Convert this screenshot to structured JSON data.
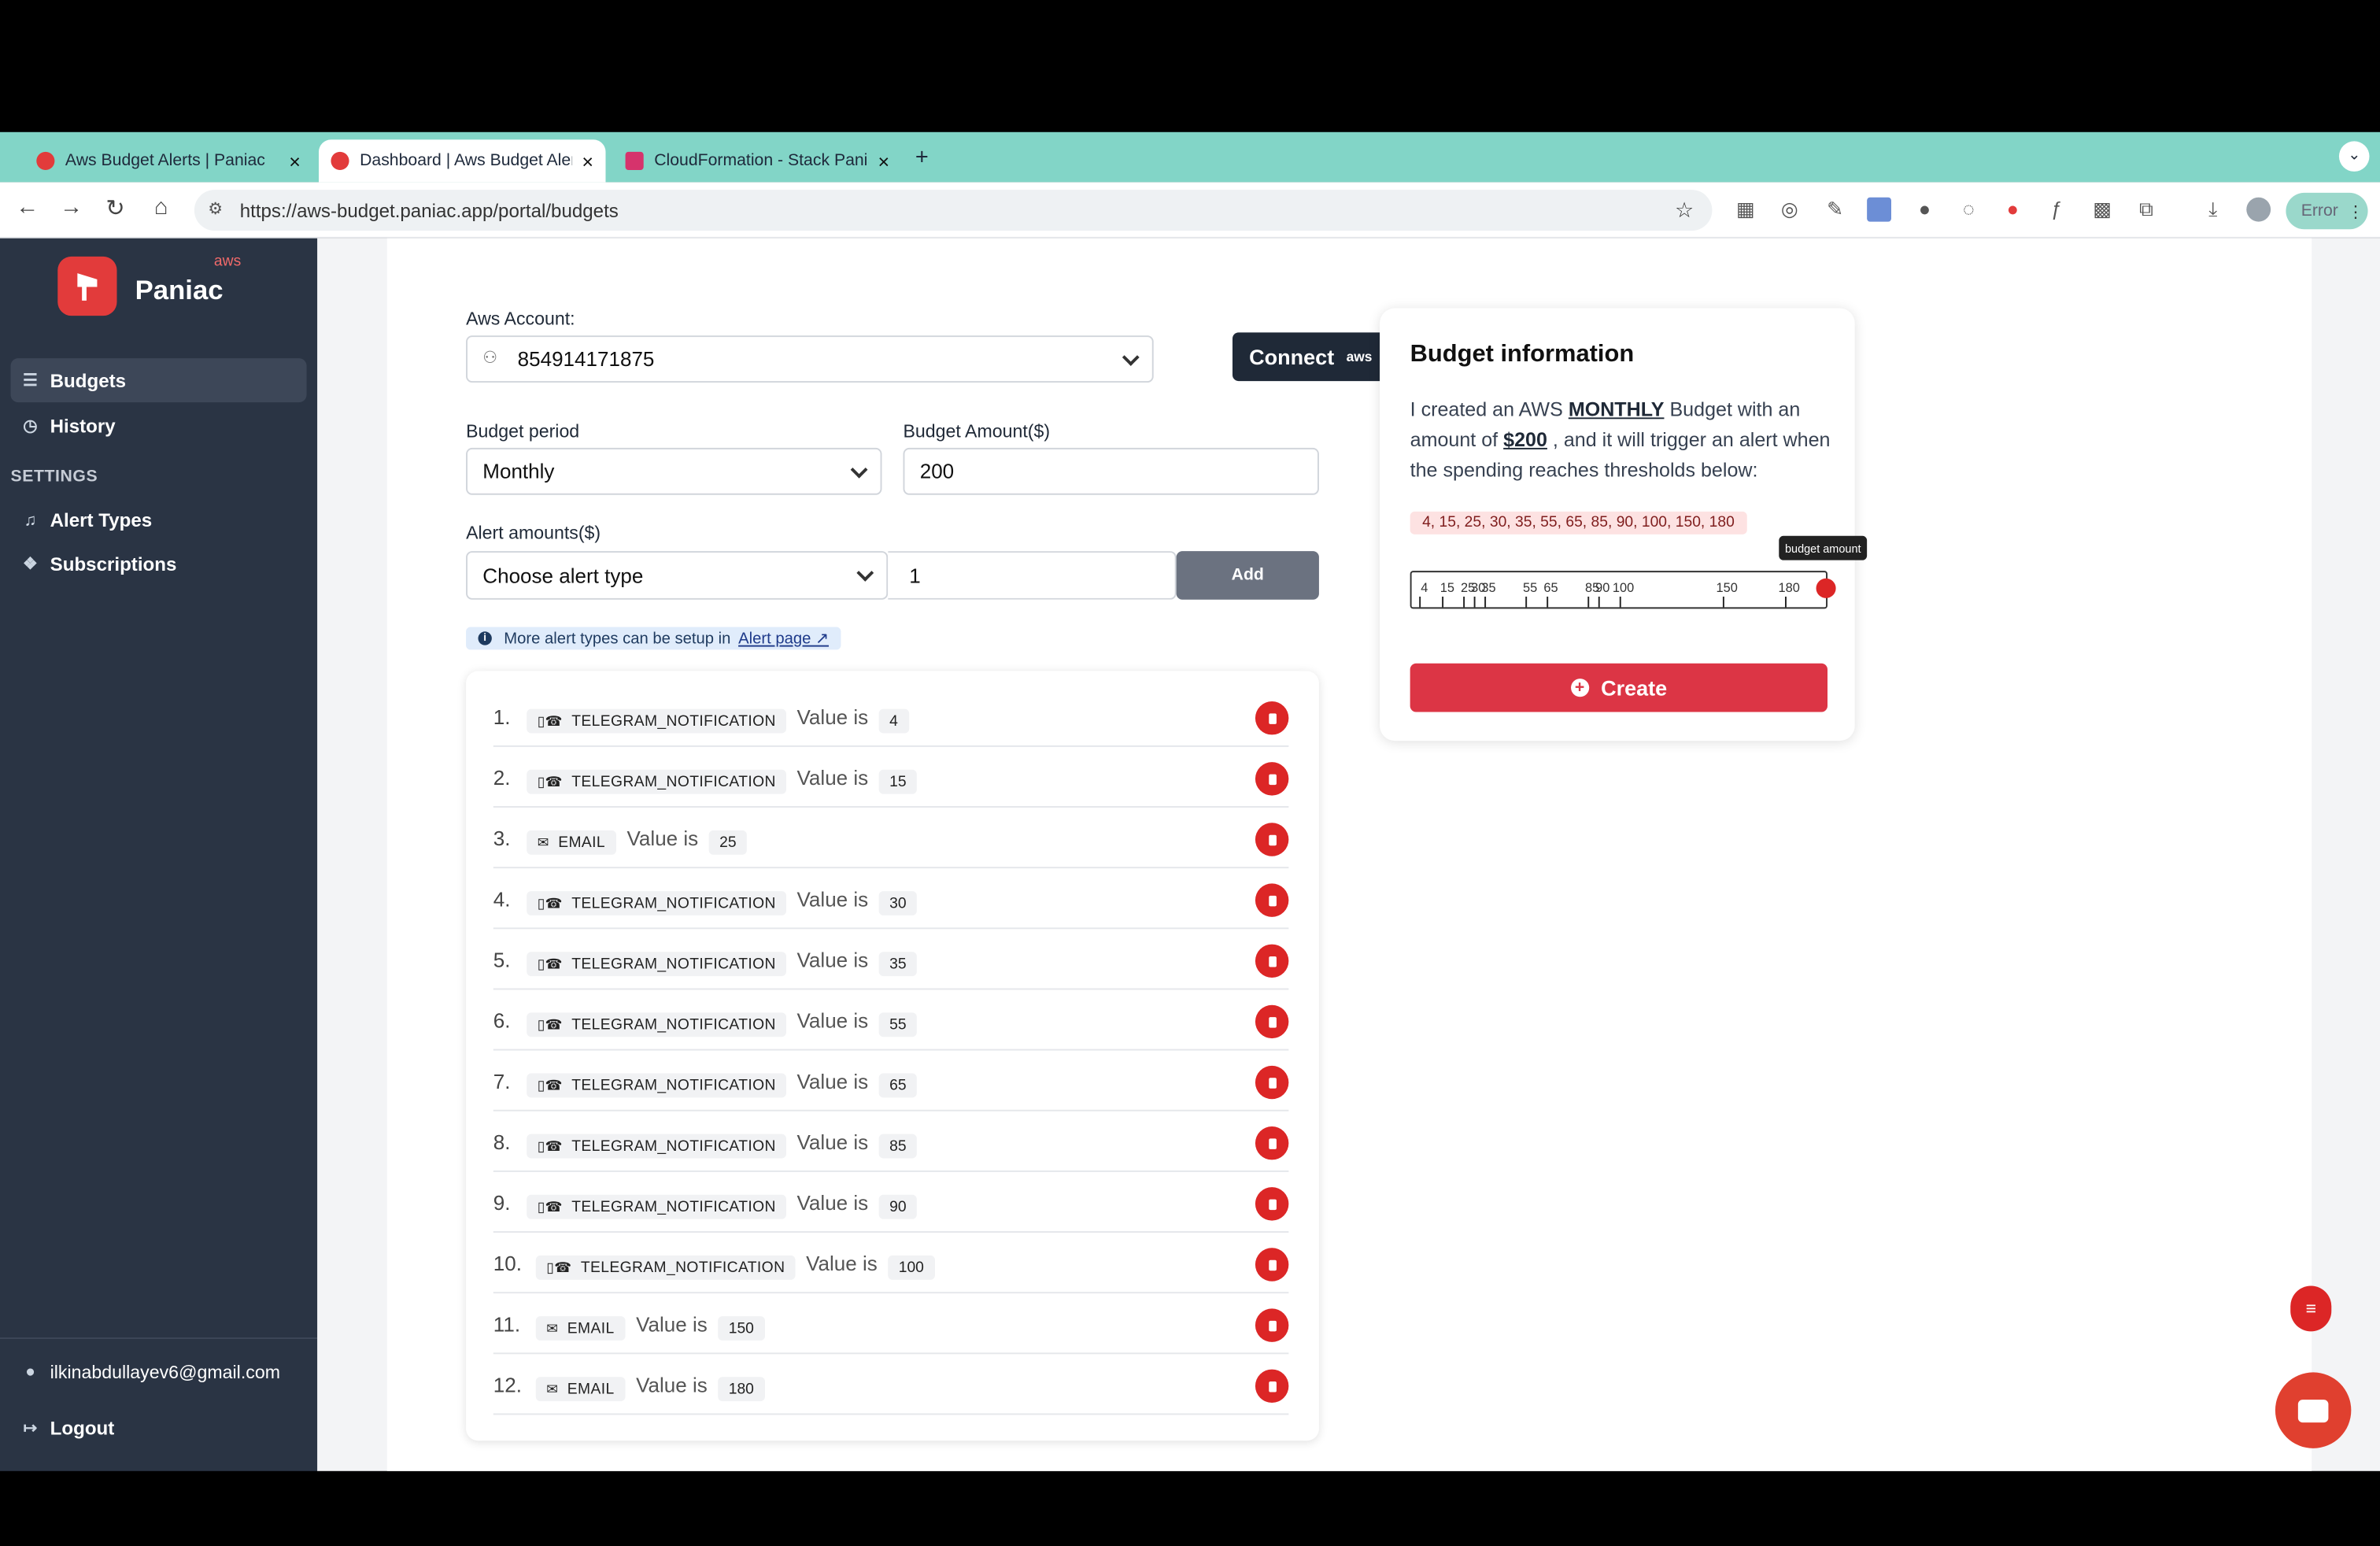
{
  "browser": {
    "tabs": [
      {
        "title": "Aws Budget Alerts | Paniac",
        "close": "×"
      },
      {
        "title": "Dashboard | Aws Budget Aler",
        "close": "×"
      },
      {
        "title": "CloudFormation - Stack Pania",
        "close": "×"
      }
    ],
    "new_tab": "+",
    "url": "https://aws-budget.paniac.app/portal/budgets",
    "error_label": "Error"
  },
  "sidebar": {
    "brand": "Paniac",
    "brand_badge": "aws",
    "nav": [
      {
        "label": "Budgets",
        "icon": "list-icon"
      },
      {
        "label": "History",
        "icon": "history-icon"
      }
    ],
    "settings_label": "SETTINGS",
    "settings": [
      {
        "label": "Alert Types",
        "icon": "bell-icon"
      },
      {
        "label": "Subscriptions",
        "icon": "subscriptions-icon"
      }
    ],
    "user_email": "ilkinabdullayev6@gmail.com",
    "logout": "Logout"
  },
  "form": {
    "aws_account_label": "Aws Account:",
    "aws_account_value": "854914171875",
    "connect_label": "Connect",
    "connect_badge": "aws",
    "budget_period_label": "Budget period",
    "budget_period_value": "Monthly",
    "budget_amount_label": "Budget Amount($)",
    "budget_amount_value": "200",
    "alert_amounts_label": "Alert amounts($)",
    "alert_type_placeholder": "Choose alert type",
    "alert_amount_value": "1",
    "add_label": "Add",
    "info_text": "More alert types can be setup in",
    "info_link": "Alert page ↗"
  },
  "alerts_value_label": "Value is",
  "alerts": [
    {
      "index": "1.",
      "type": "TELEGRAM_NOTIFICATION",
      "value": "4"
    },
    {
      "index": "2.",
      "type": "TELEGRAM_NOTIFICATION",
      "value": "15"
    },
    {
      "index": "3.",
      "type": "EMAIL",
      "value": "25"
    },
    {
      "index": "4.",
      "type": "TELEGRAM_NOTIFICATION",
      "value": "30"
    },
    {
      "index": "5.",
      "type": "TELEGRAM_NOTIFICATION",
      "value": "35"
    },
    {
      "index": "6.",
      "type": "TELEGRAM_NOTIFICATION",
      "value": "55"
    },
    {
      "index": "7.",
      "type": "TELEGRAM_NOTIFICATION",
      "value": "65"
    },
    {
      "index": "8.",
      "type": "TELEGRAM_NOTIFICATION",
      "value": "85"
    },
    {
      "index": "9.",
      "type": "TELEGRAM_NOTIFICATION",
      "value": "90"
    },
    {
      "index": "10.",
      "type": "TELEGRAM_NOTIFICATION",
      "value": "100"
    },
    {
      "index": "11.",
      "type": "EMAIL",
      "value": "150"
    },
    {
      "index": "12.",
      "type": "EMAIL",
      "value": "180"
    }
  ],
  "budget_info": {
    "title": "Budget information",
    "text_1": "I created an AWS",
    "period": "MONTHLY",
    "text_2": "Budget with an amount of",
    "amount": "$200",
    "text_3": ", and it will trigger an alert when the spending reaches thresholds below:",
    "thresholds_text": "4, 15, 25, 30, 35, 55, 65, 85, 90, 100, 150, 180",
    "tooltip": "budget amount",
    "create_label": "Create",
    "slider_max": 200,
    "marks": [
      4,
      15,
      25,
      30,
      35,
      55,
      65,
      85,
      90,
      100,
      150,
      180
    ]
  },
  "colors": {
    "accent_red": "#dc2626",
    "sidebar_bg": "#2a3444",
    "tabbar_bg": "#82d5c7"
  }
}
